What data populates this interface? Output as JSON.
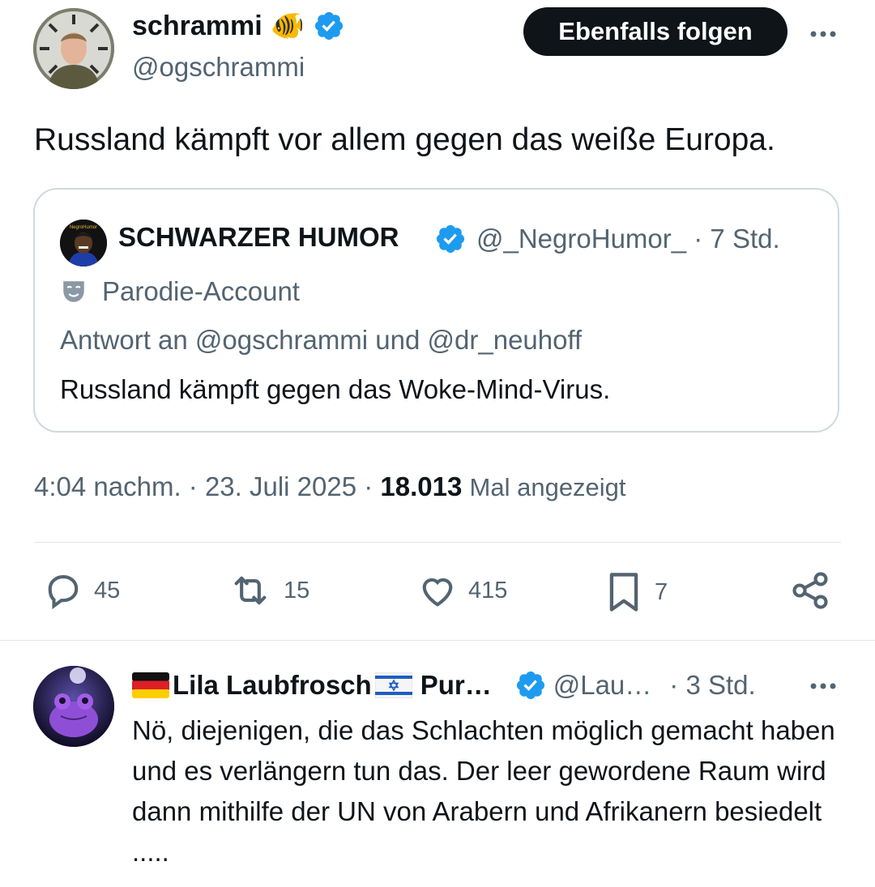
{
  "tweet": {
    "author_name": "schrammi",
    "author_emoji": "🐠",
    "author_handle": "@ogschrammi",
    "follow_label": "Ebenfalls folgen",
    "text": "Russland kämpft vor allem gegen das weiße Europa.",
    "time": "4:04 nachm. · 23. Juli 2025 ·",
    "views_count": "18.013",
    "views_label": "Mal angezeigt"
  },
  "quote": {
    "name": "SCHWARZER HUMOR",
    "handle": "@_NegroHumor_ · 7 Std.",
    "avatar_text": "NegroHumor",
    "parody_label": "Parodie-Account",
    "reply_to": "Antwort an @ogschrammi und @dr_neuhoff",
    "text": "Russland kämpft gegen das Woke-Mind-Virus."
  },
  "actions": {
    "replies": "45",
    "retweets": "15",
    "likes": "415",
    "bookmarks": "7"
  },
  "reply": {
    "name": "Lila Laubfrosch",
    "name_suffix": "Pur…",
    "handle": "@Lau…",
    "time": "· 3 Std.",
    "text": "Nö, diejenigen, die das Schlachten möglich gemacht haben und es verlängern tun das. Der leer gewordene Raum wird dann mithilfe der UN von Arabern und Afrikanern besiedelt ....."
  },
  "colors": {
    "text": "#0f1419",
    "secondary": "#536471",
    "verified": "#1d9bf0",
    "border": "#cfd9de"
  },
  "icons": [
    "verified-badge-icon",
    "more-icon",
    "parody-mask-icon",
    "reply-icon",
    "retweet-icon",
    "like-icon",
    "bookmark-icon",
    "share-icon",
    "germany-flag-icon",
    "israel-flag-icon"
  ]
}
